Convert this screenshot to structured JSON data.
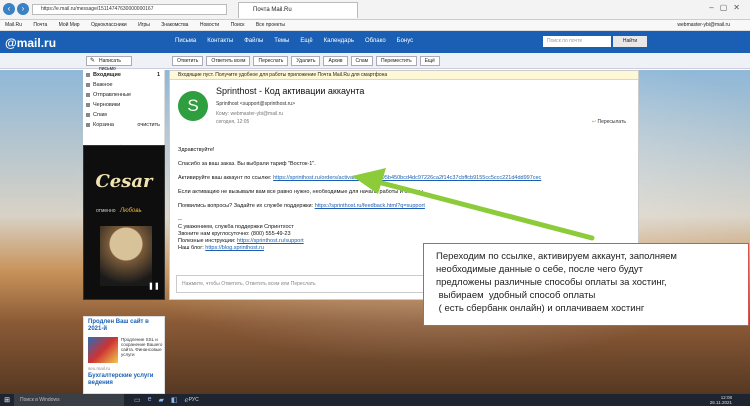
{
  "browser": {
    "address": "https://e.mail.ru/message/15114747630000000167",
    "tab": "Почта Mail.Ru",
    "favorites": [
      "Mail.Ru",
      "Почта",
      "Мой Мир",
      "Одноклассники",
      "Игры",
      "Знакомства",
      "Новости",
      "Поиск",
      "Все проекты"
    ],
    "user": "webmaster-ybi@mail.ru"
  },
  "mail_header": {
    "logo": "@mail.ru",
    "menu": [
      "Письма",
      "Контакты",
      "Файлы",
      "Темы",
      "Ещё",
      "Календарь",
      "Облако",
      "Бонус"
    ],
    "search_placeholder": "Поиск по почте",
    "search_button": "Найти"
  },
  "toolbar": {
    "write": "Написать письмо",
    "buttons": [
      "Ответить",
      "Ответить всем",
      "Переслать",
      "Удалить",
      "Архив",
      "Спам",
      "Переместить",
      "Ещё"
    ]
  },
  "sidebar": {
    "folders": [
      {
        "label": "Входящие",
        "count": "1"
      },
      {
        "label": "Важное",
        "count": ""
      },
      {
        "label": "Отправленные",
        "count": ""
      },
      {
        "label": "Черновики",
        "count": ""
      },
      {
        "label": "Спам",
        "count": ""
      },
      {
        "label": "Корзина",
        "count": "очистить"
      }
    ]
  },
  "ad": {
    "brand": "Cesar",
    "tag1": "отменно",
    "tag2": "Любовь"
  },
  "news": {
    "heading": "Продлен Ваш сайт в 2021-й",
    "text": "Продление SSL и сохранение Вашего сайта. Финансовые услуги",
    "source": "seo.mail.ru",
    "heading2": "Бухгалтерские услуги ведения"
  },
  "email": {
    "notice": "Входящие пуст. Получите удобное для работы приложение Почта Mail.Ru для смартфона",
    "avatar": "S",
    "subject": "Sprinthost - Код активации аккаунта",
    "from": "Sprinthost <support@sprinthost.ru>",
    "to": "Кому: webmaster-ybi@mail.ru",
    "date": "сегодня, 12:05",
    "priority": "Пересылать",
    "greeting": "Здравствуйте!",
    "thanks": "Спасибо за ваш заказ. Вы выбрали тариф \"Восток-1\".",
    "activate_text": "Активируйте ваш аккаунт по ссылке:",
    "activate_link": "https://sprinthost.ru/orders/activate?code=7395b450bcd4dc97226ca2f14c37cbffcb9155cc5ccc221d4dd997cec",
    "ignore": "Если активацию не вызывали вам все равно нужно, необходимые для начала работы и оплаты.",
    "questions": "Появились вопросы? Задайте их службе поддержки:",
    "support_link": "https://sprinthost.ru/feedback.html?q=support",
    "sig1": "--",
    "sig2": "С уважением, служба поддержки Спринтхост",
    "sig3": "Звоните нам круглосуточно: (800) 555-49-23",
    "sig4_text": "Полезные инструкции:",
    "sig4_link": "https://sprinthost.ru/support",
    "sig5_text": "Наш блог:",
    "sig5_link": "https://blog.sprinthost.ru",
    "reply_placeholder": "Нажмите, чтобы Ответить, Ответить всем или Переслать"
  },
  "callout": "Переходим по ссылке, активируем аккаунт, заполняем\nнеобходимые данные о себе, после чего будут\nпредложены различные способы оплаты за хостинг,\n выбираем  удобный способ оплаты\n ( есть сбербанк онлайн) и оплачиваем хостинг",
  "taskbar": {
    "search": "Поиск в Windows",
    "lang": "РУС",
    "time": "12:08",
    "date": "26.11.2021"
  }
}
